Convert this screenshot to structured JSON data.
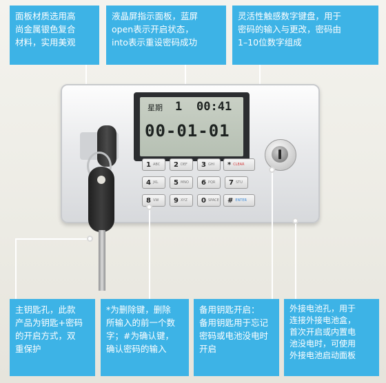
{
  "callouts": {
    "top_left": "面板材质选用高\n尚金属银色复合\n材料，实用美观",
    "top_middle": "液晶屏指示面板，蓝屏\nopen表示开启状态，\ninto表示重设密码成功",
    "top_right": "灵活性触感数字键盘，用于\n密码的输入与更改，密码由\n1–10位数字组成",
    "bottom_1": "主钥匙孔，此款\n产品为钥匙+密码\n的开启方式，双\n重保护",
    "bottom_2": "*为删除键，删除\n所输入的前一个数\n字；#为确认键，\n确认密码的输入",
    "bottom_3": "备用钥匙开启：\n备用钥匙用于忘记\n密码或电池没电时\n开启",
    "bottom_4": "外接电池孔，用于\n连接外接电池盒，\n首次开启或内置电\n池没电时，可使用\n外接电池启动面板"
  },
  "lcd": {
    "weekday_label": "星期",
    "weekday_value": "1",
    "time": "00:41",
    "date": "00-01-01"
  },
  "keypad": {
    "keys": [
      {
        "main": "1",
        "sub": "ABC"
      },
      {
        "main": "2",
        "sub": "DEF"
      },
      {
        "main": "3",
        "sub": "GHI"
      },
      {
        "main": "*",
        "sub": "CLEAR"
      },
      {
        "main": "4",
        "sub": "JKL"
      },
      {
        "main": "5",
        "sub": "MNO"
      },
      {
        "main": "6",
        "sub": "PQR"
      },
      {
        "main": "7",
        "sub": "STU"
      },
      {
        "main": "8",
        "sub": "VW"
      },
      {
        "main": "9",
        "sub": "XYZ"
      },
      {
        "main": "0",
        "sub": "SPACE"
      },
      {
        "main": "#",
        "sub": "ENTER"
      }
    ]
  },
  "colors": {
    "callout_bg": "#3db3e6",
    "callout_text": "#ffffff"
  }
}
